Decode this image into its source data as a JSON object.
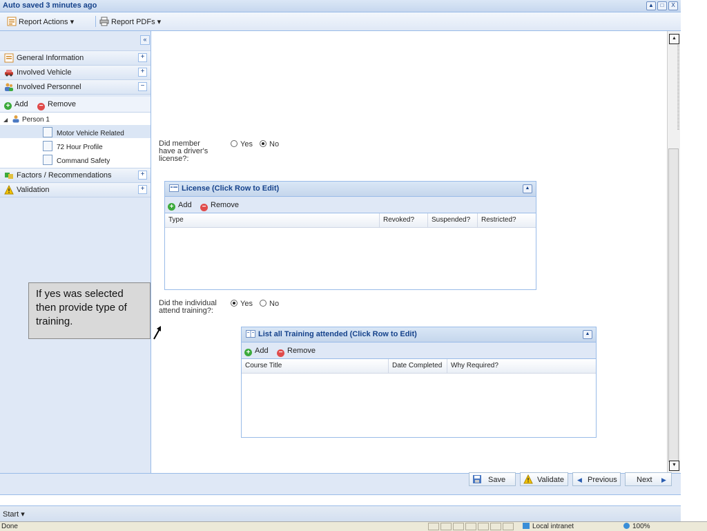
{
  "window": {
    "title": "Auto saved 3 minutes ago",
    "buttons": [
      "▲",
      "□",
      "X"
    ]
  },
  "toolbar": {
    "report_actions": "Report Actions ▾",
    "report_pdfs": "Report PDFs ▾"
  },
  "sidebar": {
    "collapse": "«",
    "sections": [
      {
        "label": "General Information",
        "toggle": "+"
      },
      {
        "label": "Involved Vehicle",
        "toggle": "+"
      },
      {
        "label": "Involved Personnel",
        "toggle": "−"
      },
      {
        "label": "Factors / Recommendations",
        "toggle": "+"
      },
      {
        "label": "Validation",
        "toggle": "+"
      }
    ],
    "add_label": "Add",
    "remove_label": "Remove",
    "tree": {
      "person": "Person 1",
      "items": [
        "Motor Vehicle Related",
        "72 Hour Profile",
        "Command Safety"
      ]
    }
  },
  "form": {
    "q1": {
      "label": "Did member have a driver's license?:",
      "yes": "Yes",
      "no": "No",
      "selected": "No"
    },
    "license_grid": {
      "title": "License (Click Row to Edit)",
      "add": "Add",
      "remove": "Remove",
      "columns": [
        "Type",
        "Revoked?",
        "Suspended?",
        "Restricted?"
      ]
    },
    "q2": {
      "label": "Did the individual attend training?:",
      "yes": "Yes",
      "no": "No",
      "selected": "Yes"
    },
    "training_grid": {
      "title": "List all Training attended (Click Row to Edit)",
      "add": "Add",
      "remove": "Remove",
      "columns": [
        "Course Title",
        "Date Completed",
        "Why Required?"
      ]
    }
  },
  "callout": {
    "text": "If yes was selected then provide type of training."
  },
  "footer": {
    "save": "Save",
    "validate": "Validate",
    "previous": "Previous",
    "next": "Next"
  },
  "taskbar": {
    "start": "Start ▾"
  },
  "status": {
    "left": "Done",
    "zone": "Local intranet",
    "zoom": "100%"
  },
  "colors": {
    "header_blue": "#15428b",
    "panel": "#dfe8f6",
    "border": "#99bbe8"
  }
}
